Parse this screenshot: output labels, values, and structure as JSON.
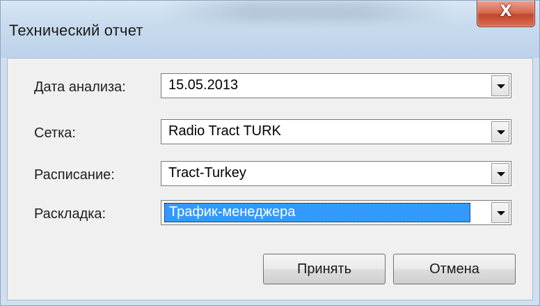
{
  "window": {
    "title": "Технический отчет",
    "close_glyph": "X"
  },
  "form": {
    "rows": [
      {
        "label": "Дата анализа:",
        "value": "15.05.2013",
        "selected": false
      },
      {
        "label": "Сетка:",
        "value": "Radio Tract TURK",
        "selected": false
      },
      {
        "label": "Расписание:",
        "value": "Tract-Turkey",
        "selected": false
      },
      {
        "label": "Раскладка:",
        "value": "Трафик-менеджера",
        "selected": true
      }
    ]
  },
  "buttons": {
    "ok_label": "Принять",
    "cancel_label": "Отмена"
  },
  "icons": {
    "close": "close-icon",
    "dropdown": "chevron-down-icon"
  },
  "colors": {
    "selection": "#3399ff",
    "close_button": "#c2472c"
  }
}
